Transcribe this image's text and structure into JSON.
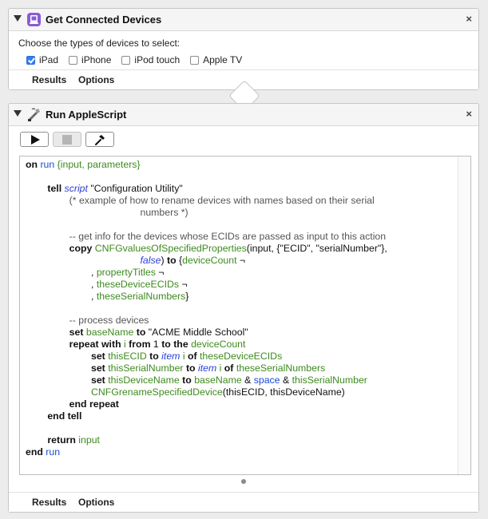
{
  "action1": {
    "title": "Get Connected Devices",
    "prompt": "Choose the types of devices to select:",
    "options": [
      {
        "label": "iPad",
        "checked": true
      },
      {
        "label": "iPhone",
        "checked": false
      },
      {
        "label": "iPod touch",
        "checked": false
      },
      {
        "label": "Apple TV",
        "checked": false
      }
    ],
    "footer": {
      "results": "Results",
      "options": "Options"
    },
    "close": "×"
  },
  "action2": {
    "title": "Run AppleScript",
    "close": "×",
    "toolbar": {
      "run_icon": "play-icon",
      "stop_icon": "stop-icon",
      "compile_icon": "hammer-icon"
    },
    "footer": {
      "results": "Results",
      "options": "Options"
    }
  },
  "code": {
    "l1_on": "on",
    "l1_run": "run",
    "l1_params": "{input, parameters}",
    "l3_tell": "tell",
    "l3_script": "script",
    "l3_app": "\"Configuration Utility\"",
    "l4": "(* example of how to rename devices with names based on their serial",
    "l5": "numbers *)",
    "l7": "-- get info for the devices whose ECIDs are passed as input to this action",
    "l8_copy": "copy",
    "l8_handler": "CNFGvaluesOfSpecifiedProperties",
    "l8_args": "(input, {\"ECID\", \"serialNumber\"},",
    "l9_false": "false",
    "l9_to": "to",
    "l9_deviceCount": "deviceCount",
    "l10": "propertyTitles",
    "l11": "theseDeviceECIDs",
    "l12": "theseSerialNumbers",
    "l14": "-- process devices",
    "l15_set": "set",
    "l15_var": "baseName",
    "l15_to": "to",
    "l15_val": "\"ACME Middle School\"",
    "l16_repeat": "repeat with",
    "l16_i": "i",
    "l16_from": "from",
    "l16_1": "1",
    "l16_to": "to the",
    "l16_count": "deviceCount",
    "l17_var": "thisECID",
    "l18_var": "thisSerialNumber",
    "l19_var": "thisDeviceName",
    "l19_space": "space",
    "l20_handler": "CNFGrenameSpecifiedDevice",
    "l20_args": "(thisECID, thisDeviceName)",
    "l21": "end repeat",
    "l22": "end tell",
    "l24_return": "return",
    "l24_input": "input",
    "l25_end": "end",
    "l25_run": "run",
    "item": "item",
    "of": "of"
  }
}
